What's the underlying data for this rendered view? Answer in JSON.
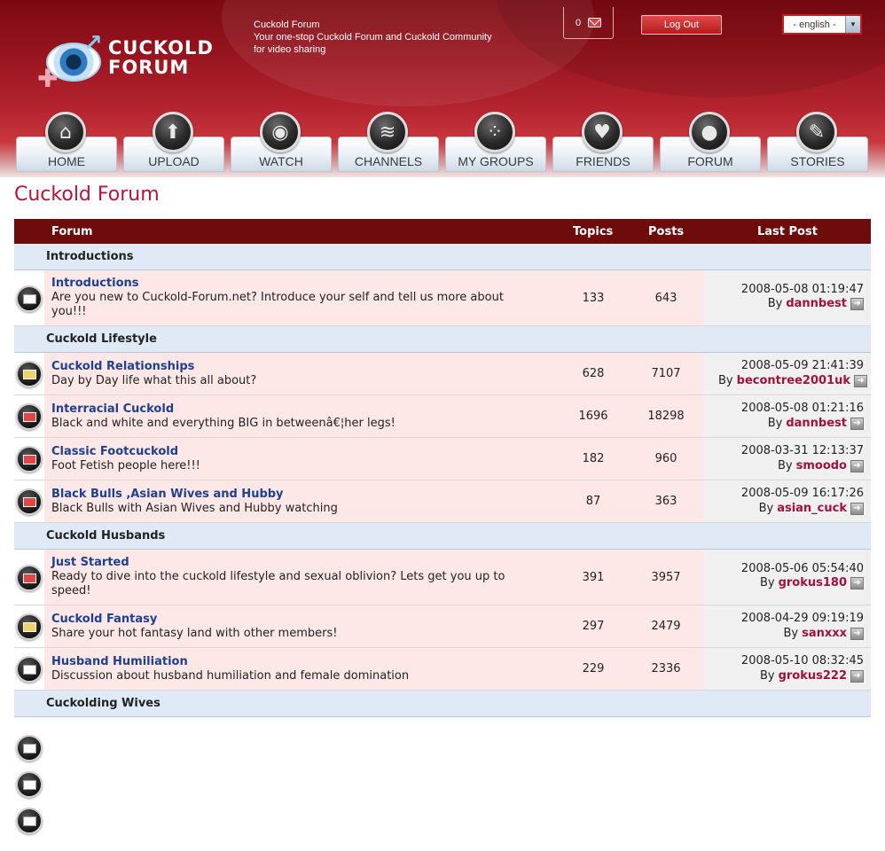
{
  "header": {
    "logo_line1": "CUCKOLD",
    "logo_line2": "FORUM",
    "tagline": "Cuckold Forum\nYour one-stop Cuckold Forum and Cuckold Community for video sharing",
    "tagline_lines": [
      "Cuckold Forum",
      "Your one-stop Cuckold Forum and Cuckold Community",
      "for video sharing"
    ],
    "message_count": "0",
    "logout_label": "Log Out",
    "language": "- english -"
  },
  "nav": [
    {
      "label": "HOME",
      "icon": "home-icon"
    },
    {
      "label": "UPLOAD",
      "icon": "upload-arrow-icon"
    },
    {
      "label": "WATCH",
      "icon": "film-reel-icon"
    },
    {
      "label": "CHANNELS",
      "icon": "database-stack-icon"
    },
    {
      "label": "MY GROUPS",
      "icon": "group-bubbles-icon"
    },
    {
      "label": "FRIENDS",
      "icon": "heart-plus-icon"
    },
    {
      "label": "FORUM",
      "icon": "chat-bubble-icon"
    },
    {
      "label": "STORIES",
      "icon": "notepad-icon"
    }
  ],
  "page_title": "Cuckold Forum",
  "table_headers": {
    "forum": "Forum",
    "topics": "Topics",
    "posts": "Posts",
    "last_post": "Last Post"
  },
  "categories": [
    {
      "name": "Introductions",
      "forums": [
        {
          "title": "Introductions",
          "desc": "Are you new to Cuckold-Forum.net? Introduce your self and tell us more about you!!!",
          "topics": "133",
          "posts": "643",
          "date": "2008-05-08 01:19:47",
          "by": "By",
          "user": "dannbest"
        }
      ]
    },
    {
      "name": "Cuckold Lifestyle",
      "forums": [
        {
          "title": "Cuckold Relationships",
          "desc": "Day by Day life what this all about?",
          "topics": "628",
          "posts": "7107",
          "date": "2008-05-09 21:41:39",
          "by": "By",
          "user": "becontree2001uk"
        },
        {
          "title": "Interracial Cuckold",
          "desc": "Black and white and everything BIG in betweenâ€¦her legs!",
          "topics": "1696",
          "posts": "18298",
          "date": "2008-05-08 01:21:16",
          "by": "By",
          "user": "dannbest"
        },
        {
          "title": "Classic Footcuckold",
          "desc": "Foot Fetish people here!!!",
          "topics": "182",
          "posts": "960",
          "date": "2008-03-31 12:13:37",
          "by": "By",
          "user": "smoodo"
        },
        {
          "title": "Black Bulls ,Asian Wives and Hubby",
          "desc": "Black Bulls with Asian Wives and Hubby watching",
          "topics": "87",
          "posts": "363",
          "date": "2008-05-09 16:17:26",
          "by": "By",
          "user": "asian_cuck"
        }
      ]
    },
    {
      "name": "Cuckold Husbands",
      "forums": [
        {
          "title": "Just Started",
          "desc": "Ready to dive into the cuckold lifestyle and sexual oblivion? Lets get you up to speed!",
          "topics": "391",
          "posts": "3957",
          "date": "2008-05-06 05:54:40",
          "by": "By",
          "user": "grokus180"
        },
        {
          "title": "Cuckold Fantasy",
          "desc": "Share your hot fantasy land with other members!",
          "topics": "297",
          "posts": "2479",
          "date": "2008-04-29 09:19:19",
          "by": "By",
          "user": "sanxxx"
        },
        {
          "title": "Husband Humiliation",
          "desc": "Discussion about husband humiliation and female domination",
          "topics": "229",
          "posts": "2336",
          "date": "2008-05-10 08:32:45",
          "by": "By",
          "user": "grokus222"
        }
      ]
    },
    {
      "name": "Cuckolding Wives",
      "forums": []
    }
  ],
  "colors": {
    "accent": "#b8123a",
    "header_bar": "#6e0b0b",
    "category_bg": "#dfeaf6",
    "row_bg": "#fde7e7",
    "link": "#1f3f8f",
    "user": "#a3123b"
  }
}
